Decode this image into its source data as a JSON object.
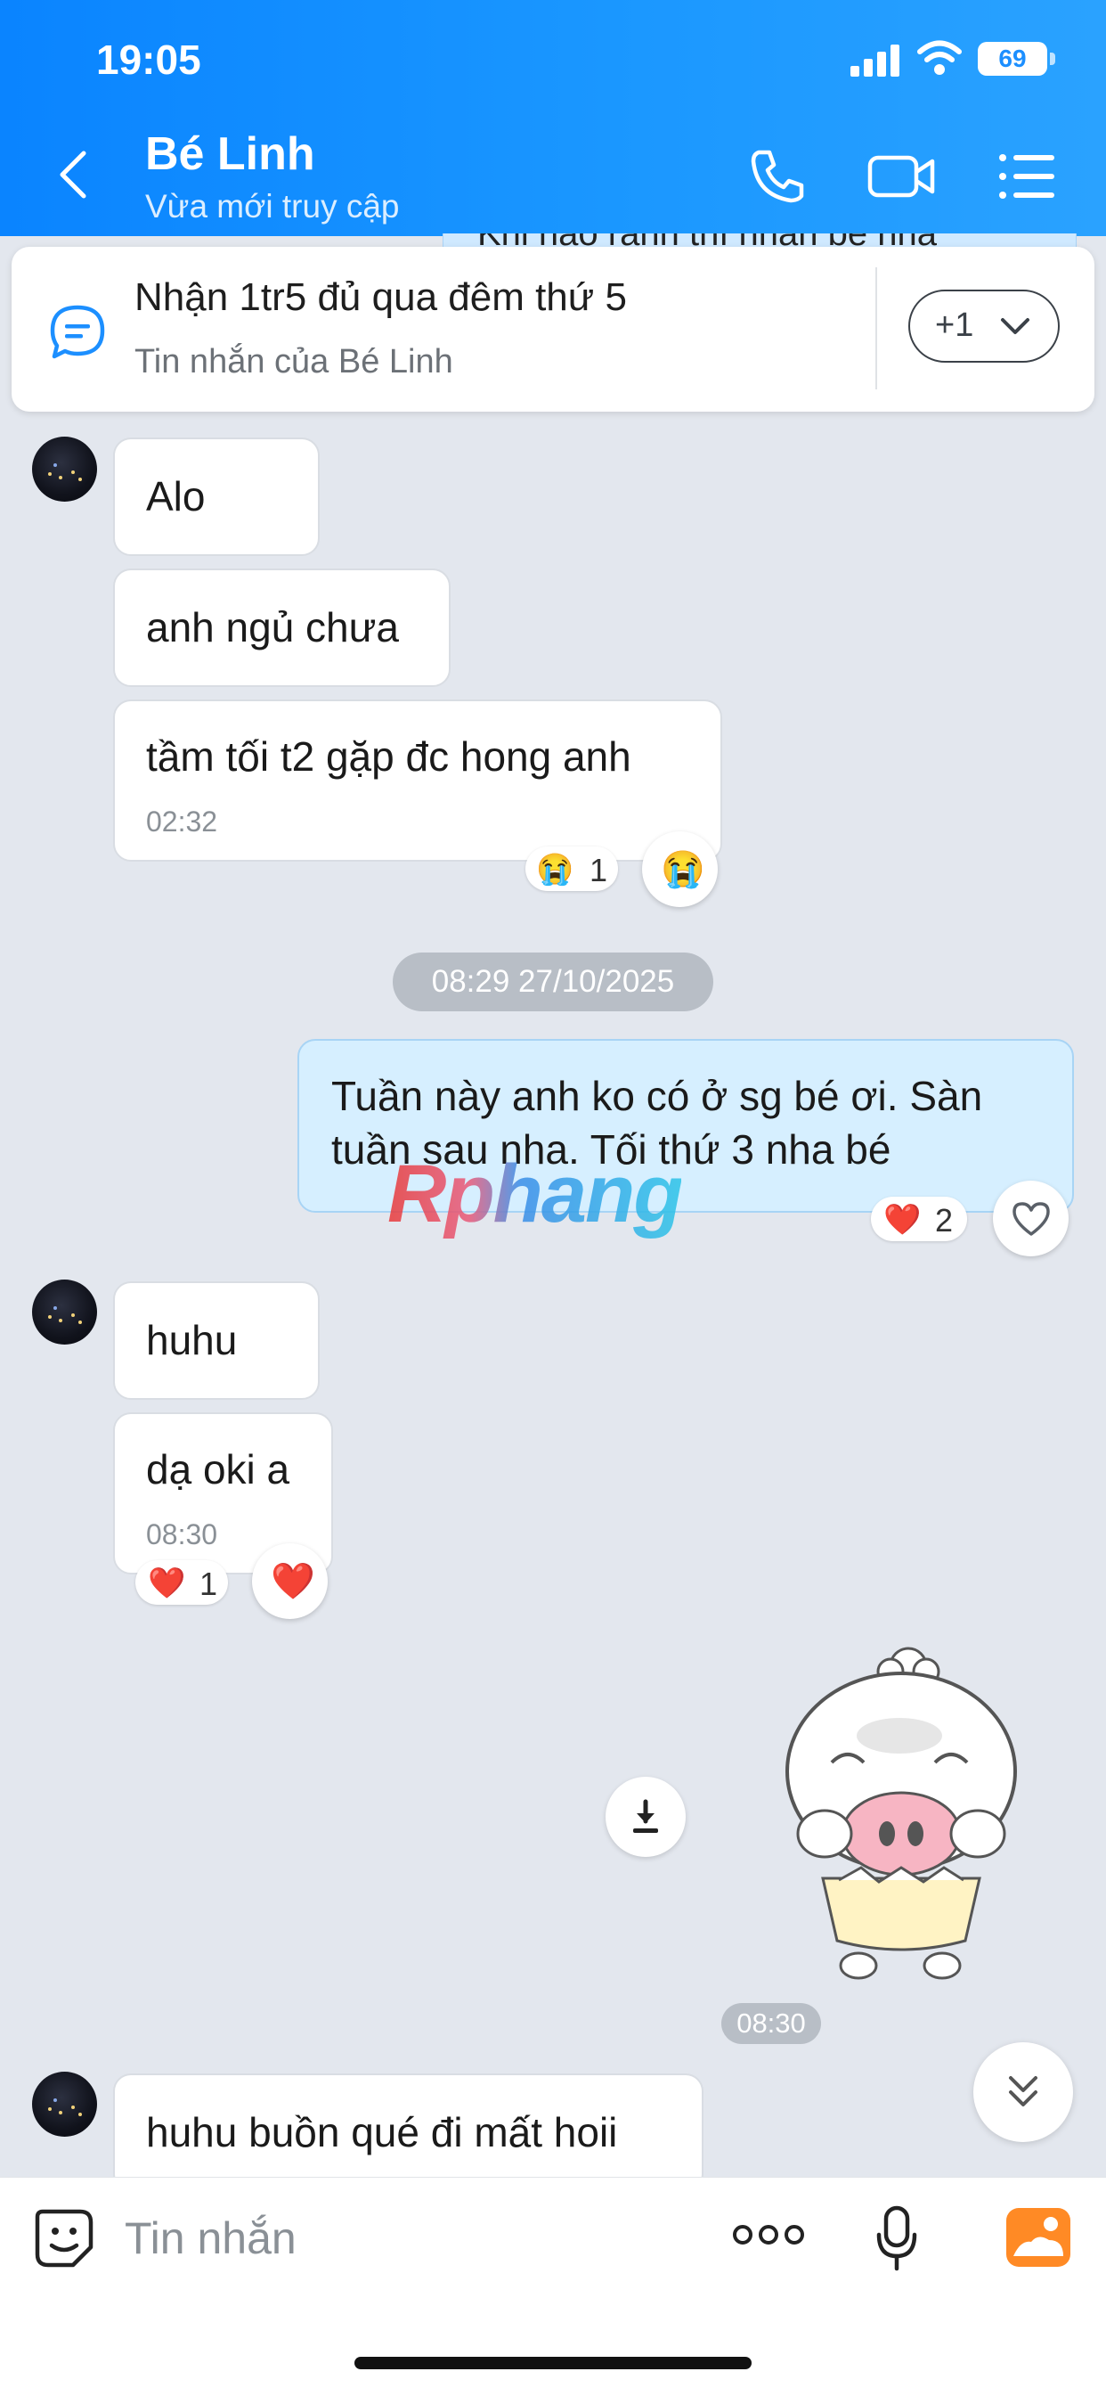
{
  "status_bar": {
    "time": "19:05",
    "battery": "69"
  },
  "header": {
    "contact_name": "Bé Linh",
    "status": "Vừa mới truy cập"
  },
  "pinned": {
    "peek_text": "Khi nào rảnh thì nhắn bé nha",
    "title": "Nhận 1tr5 đủ qua đêm thứ 5",
    "subtitle": "Tin nhắn của Bé Linh",
    "more_label": "+1"
  },
  "messages": {
    "m1": {
      "text": "Alo"
    },
    "m2": {
      "text": "anh ngủ chưa"
    },
    "m3": {
      "text": "tầm tối t2 gặp đc hong anh",
      "time": "02:32",
      "reaction_count": "1"
    },
    "date_divider": "08:29 27/10/2025",
    "m4": {
      "line1": "Tuần này anh ko có ở sg bé ơi. Sàn",
      "line2": "tuần sau nha. Tối thứ 3 nha bé",
      "reaction_count": "2"
    },
    "m5": {
      "text": "huhu"
    },
    "m6": {
      "text": "dạ oki a",
      "time": "08:30",
      "reaction_count": "1"
    },
    "sticker_time": "08:30",
    "m7": {
      "text": "huhu buồn qué đi mất hoii"
    }
  },
  "watermark": "Rphang",
  "composer": {
    "placeholder": "Tin nhắn"
  },
  "icons": {
    "back": "chevron-left-icon",
    "call": "phone-icon",
    "video": "video-camera-icon",
    "menu": "list-menu-icon",
    "pinned": "chat-bubble-icon",
    "sticker": "emoji-icon",
    "more": "more-dots-icon",
    "mic": "microphone-icon",
    "image": "image-gallery-icon",
    "download": "download-icon",
    "scroll": "double-chevron-down-icon"
  },
  "colors": {
    "header": "#0a84ff",
    "outgoing_bubble": "#d6efff",
    "incoming_bubble": "#ffffff",
    "background": "#e3e7ee"
  }
}
